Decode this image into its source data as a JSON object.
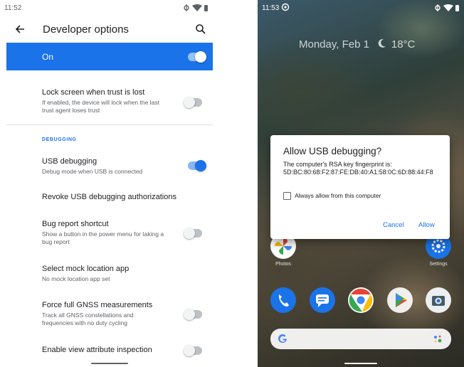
{
  "left_phone": {
    "status_time": "11:52",
    "title": "Developer options",
    "master_switch": {
      "label": "On",
      "on": true
    },
    "settings": {
      "lock": {
        "title": "Lock screen when trust is lost",
        "summary": "If enabled, the device will lock when the last trust agent loses trust",
        "on": false
      },
      "section_header": "DEBUGGING",
      "usb": {
        "title": "USB debugging",
        "summary": "Debug mode when USB is connected",
        "on": true
      },
      "revoke": {
        "title": "Revoke USB debugging authorizations"
      },
      "bugreport": {
        "title": "Bug report shortcut",
        "summary": "Show a button in the power menu for taking a bug report",
        "on": false
      },
      "mock": {
        "title": "Select mock location app",
        "summary": "No mock location app set"
      },
      "gnss": {
        "title": "Force full GNSS measurements",
        "summary": "Track all GNSS constellations and frequencies with no duty cycling",
        "on": false
      },
      "view_attr": {
        "title": "Enable view attribute inspection",
        "on": false
      }
    },
    "colors": {
      "accent": "#1a73e8"
    }
  },
  "right_phone": {
    "status_time": "11:53",
    "date": "Monday, Feb 1",
    "temperature": "18°C",
    "dialog": {
      "title": "Allow USB debugging?",
      "message": "The computer's RSA key fingerprint is: 5D:BC:80:68:F2:87:FE:DB:40:A1:58:0C:6D:88:44:F8",
      "checkbox_label": "Always allow from this computer",
      "checkbox_checked": false,
      "cancel": "Cancel",
      "allow": "Allow"
    },
    "home_labels": {
      "photos": "Photos",
      "settings": "Settings"
    },
    "dock_icons": [
      "phone-icon",
      "messages-icon",
      "chrome-icon",
      "play-store-icon",
      "camera-icon"
    ]
  }
}
